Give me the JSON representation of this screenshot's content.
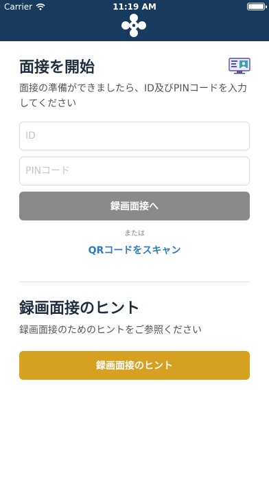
{
  "status_bar": {
    "carrier": "Carrier",
    "time": "11:19 AM"
  },
  "start": {
    "title": "面接を開始",
    "description": "面接の準備ができましたら、ID及びPINコードを入力してください",
    "id_placeholder": "ID",
    "pin_placeholder": "PINコード",
    "submit_label": "録画面接へ",
    "or_label": "または",
    "qr_label": "QRコードをスキャン"
  },
  "hints": {
    "title": "録画面接のヒント",
    "description": "録画面接のためのヒントをご参照ください",
    "button_label": "録画面接のヒント"
  },
  "colors": {
    "header": "#173a5e",
    "primary_button": "#8a8a8a",
    "hint_button": "#d6a021",
    "link": "#2b7bc0"
  },
  "icons": {
    "logo": "app-logo-icon",
    "monitor": "video-interview-icon",
    "wifi": "wifi-icon",
    "battery": "battery-icon"
  }
}
